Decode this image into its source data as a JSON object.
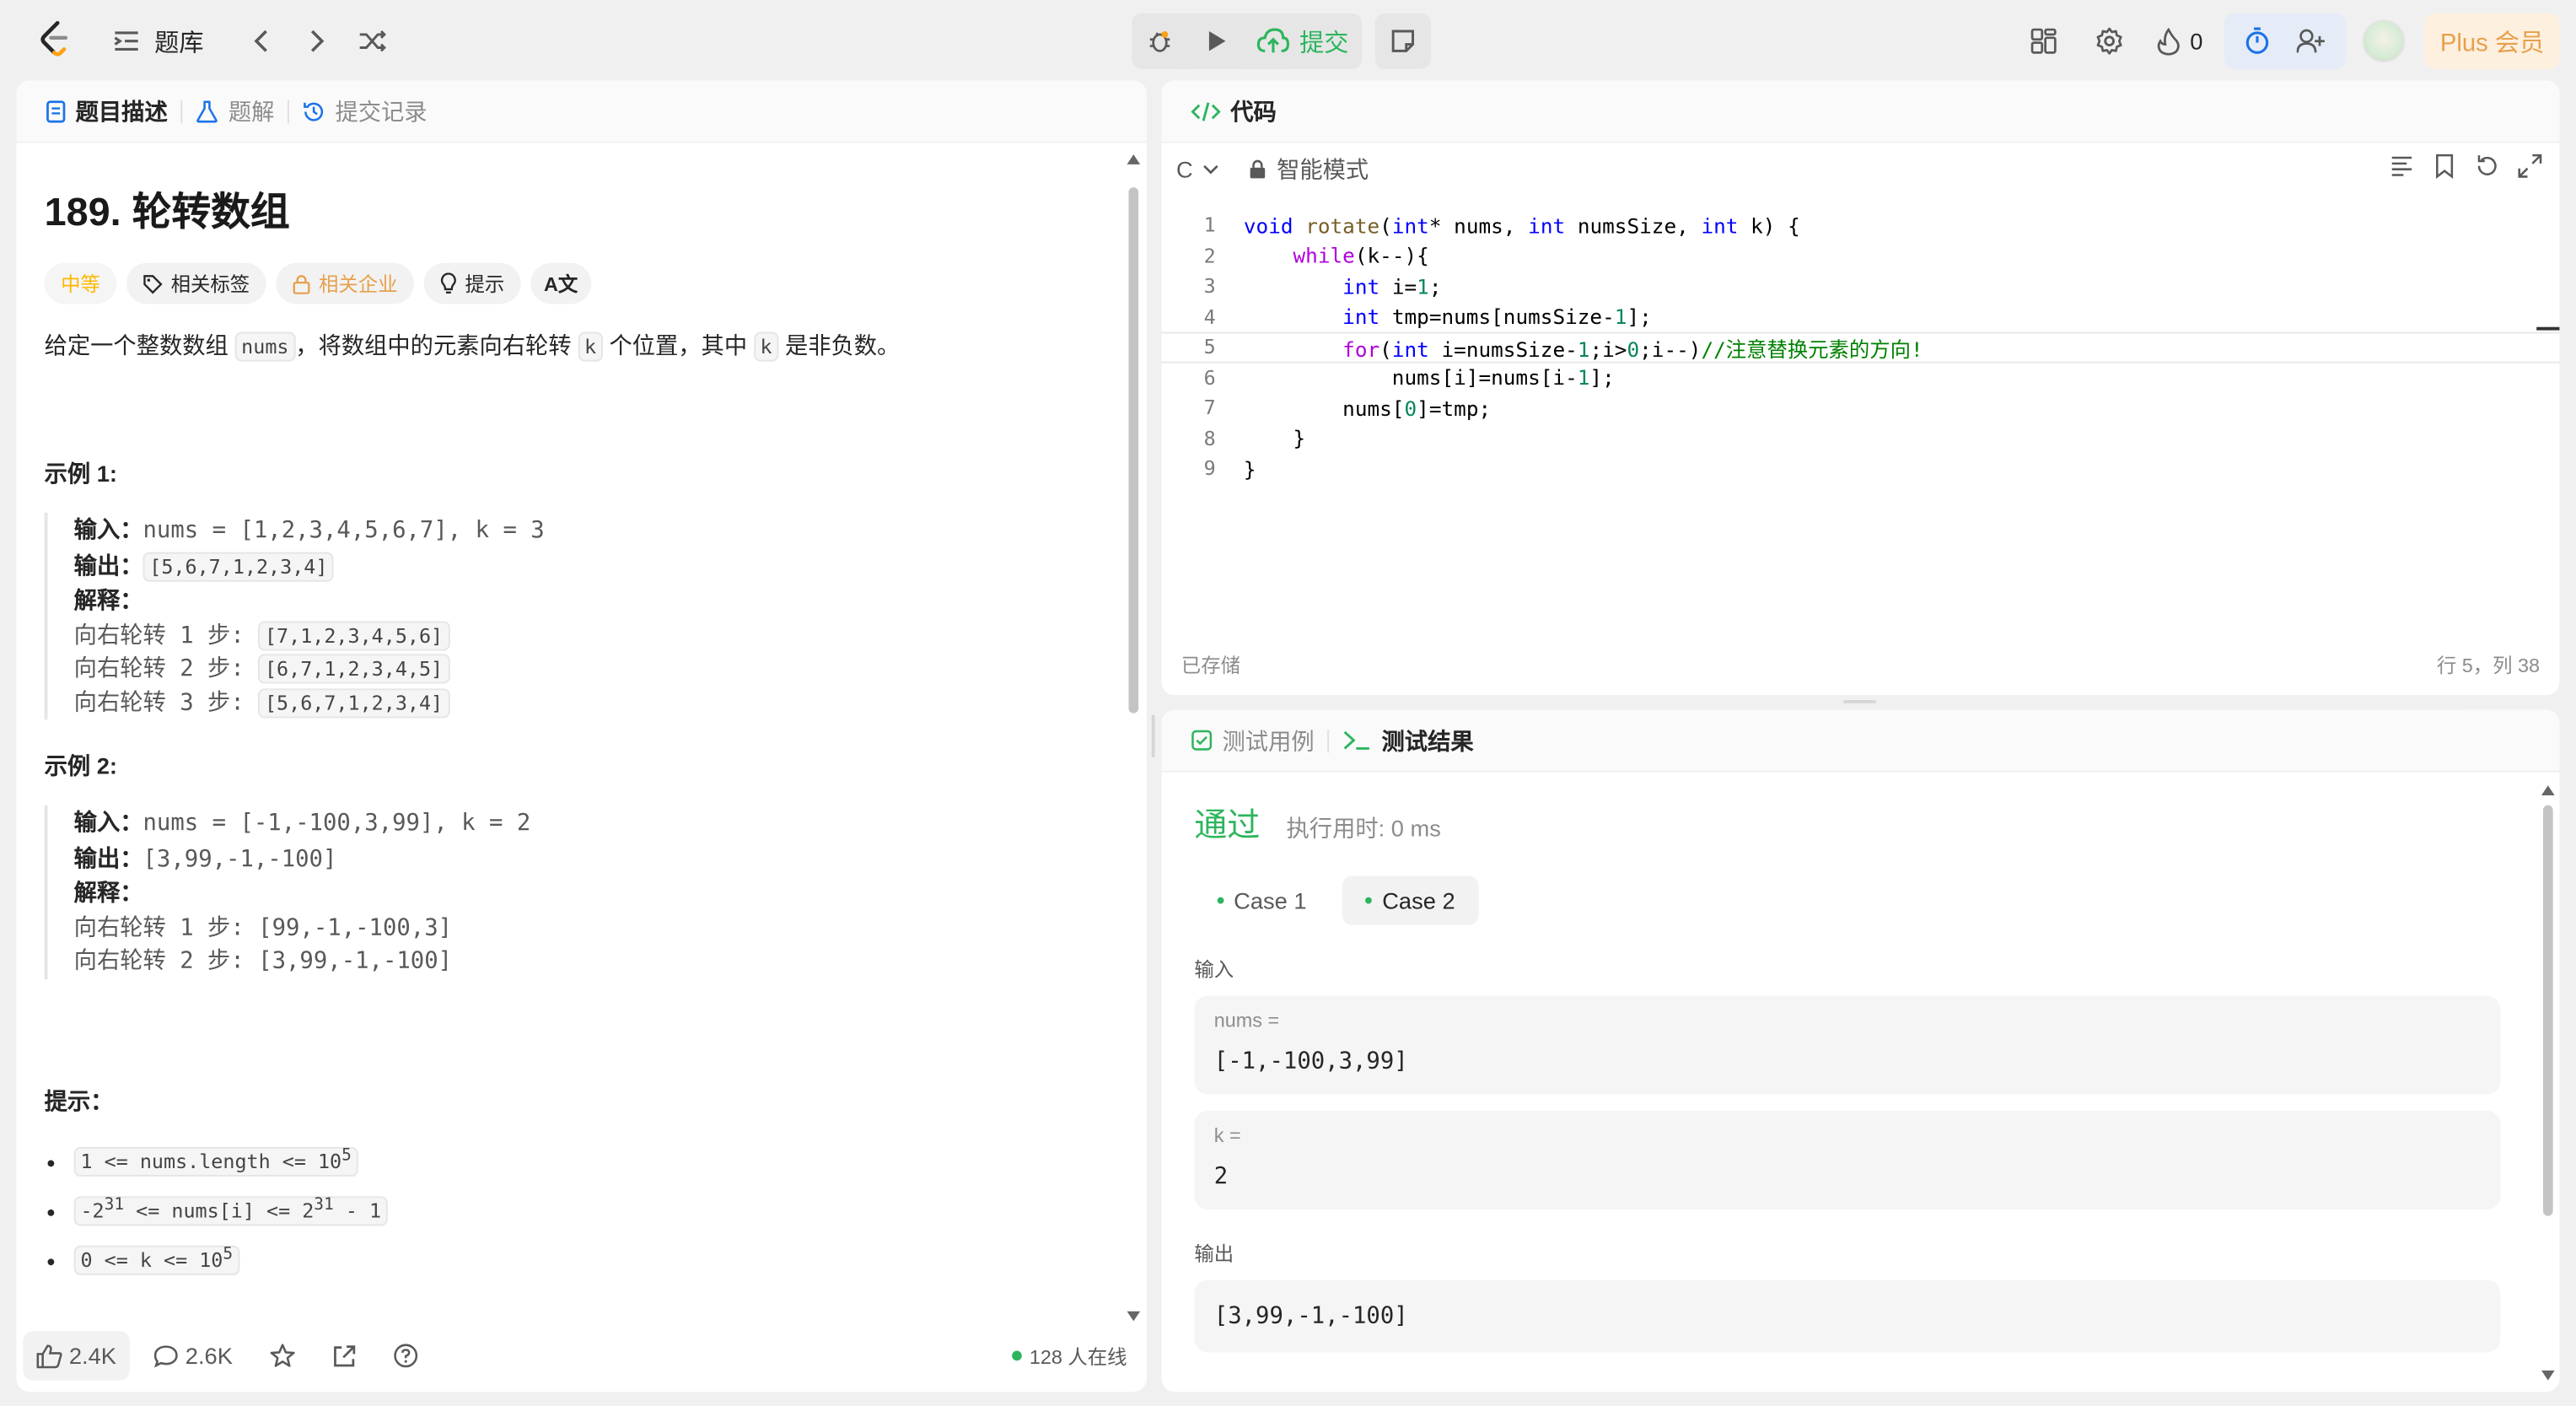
{
  "topbar": {
    "title": "题库",
    "submit_label": "提交",
    "streak_count": "0",
    "plus_label": "Plus 会员"
  },
  "left": {
    "tabs": [
      "题目描述",
      "题解",
      "提交记录"
    ],
    "problem_title": "189. 轮转数组",
    "tags": {
      "difficulty": "中等",
      "related_tags": "相关标签",
      "companies": "相关企业",
      "hint": "提示"
    },
    "desc": {
      "p1": "给定一个整数数组 ",
      "nums": "nums",
      "p2": "，将数组中的元素向右轮转 ",
      "k": "k",
      "p3": " 个位置，其中 ",
      "k2": "k",
      "p4": " 是非负数。"
    },
    "ex1": {
      "heading": "示例 1:",
      "in_label": "输入：",
      "in_value": "nums = [1,2,3,4,5,6,7], k = 3",
      "out_label": "输出：",
      "out_value": "[5,6,7,1,2,3,4]",
      "expl_label": "解释：",
      "steps": [
        {
          "text": "向右轮转 1 步: ",
          "val": "[7,1,2,3,4,5,6]"
        },
        {
          "text": "向右轮转 2 步: ",
          "val": "[6,7,1,2,3,4,5]"
        },
        {
          "text": "向右轮转 3 步: ",
          "val": "[5,6,7,1,2,3,4]"
        }
      ]
    },
    "ex2": {
      "heading": "示例 2:",
      "in_label": "输入：",
      "in_value": "nums = [-1,-100,3,99], k = 2",
      "out_label": "输出：",
      "out_value": "[3,99,-1,-100]",
      "expl_label": "解释：",
      "step1": "向右轮转 1 步: [99,-1,-100,3]",
      "step2": "向右轮转 2 步: [3,99,-1,-100]"
    },
    "hints_heading": "提示：",
    "hints": [
      {
        "pre": "1 <= nums.length <= 10",
        "sup": "5",
        "post": ""
      },
      {
        "pre": "-2",
        "sup": "31",
        "mid": " <= nums[i] <= 2",
        "sup2": "31",
        "post": " - 1"
      },
      {
        "pre": "0 <= k <= 10",
        "sup": "5",
        "post": ""
      }
    ],
    "footer": {
      "likes": "2.4K",
      "comments": "2.6K",
      "online": "128 人在线"
    }
  },
  "code": {
    "tab": "代码",
    "lang": "C",
    "mode": "智能模式",
    "saved": "已存储",
    "cursor": "行 5，列 38",
    "line_numbers": [
      "1",
      "2",
      "3",
      "4",
      "5",
      "6",
      "7",
      "8",
      "9"
    ]
  },
  "result": {
    "tabs": [
      "测试用例",
      "测试结果"
    ],
    "status": "通过",
    "runtime": "执行用时: 0 ms",
    "cases": [
      "Case 1",
      "Case 2"
    ],
    "input_label": "输入",
    "inputs": [
      {
        "name": "nums =",
        "value": "[-1,-100,3,99]"
      },
      {
        "name": "k =",
        "value": "2"
      }
    ],
    "output_label": "输出",
    "output_value": "[3,99,-1,-100]"
  },
  "colors": {
    "accent_green": "#2db55d",
    "difficulty": "#ffb800",
    "plus": "#e8a04d"
  }
}
